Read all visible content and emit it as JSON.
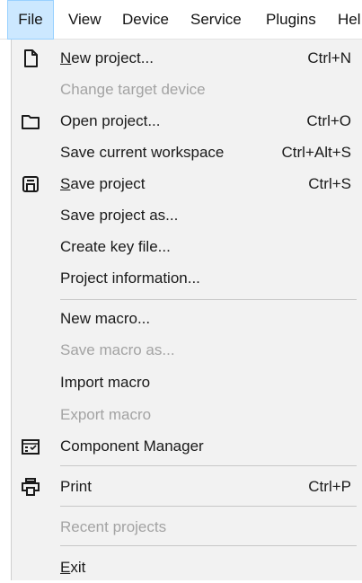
{
  "menubar": {
    "items": [
      "File",
      "View",
      "Device",
      "Service",
      "Plugins",
      "Hel"
    ]
  },
  "file_menu": {
    "new_project": {
      "label_u": "N",
      "label_rest": "ew project...",
      "shortcut": "Ctrl+N"
    },
    "change_target_device": {
      "label": "Change target device"
    },
    "open_project": {
      "label": "Open project...",
      "shortcut": "Ctrl+O"
    },
    "save_current_workspace": {
      "label": "Save current workspace",
      "shortcut": "Ctrl+Alt+S"
    },
    "save_project": {
      "label_u": "S",
      "label_rest": "ave project",
      "shortcut": "Ctrl+S"
    },
    "save_project_as": {
      "label": "Save project as..."
    },
    "create_key_file": {
      "label": "Create key file..."
    },
    "project_information": {
      "label": "Project information..."
    },
    "new_macro": {
      "label": "New macro..."
    },
    "save_macro_as": {
      "label": "Save macro as..."
    },
    "import_macro": {
      "label": "Import macro"
    },
    "export_macro": {
      "label": "Export macro"
    },
    "component_manager": {
      "label": "Component Manager"
    },
    "print": {
      "label": "Print",
      "shortcut": "Ctrl+P"
    },
    "recent_projects": {
      "label": "Recent projects"
    },
    "exit": {
      "label_u": "E",
      "label_rest": "xit"
    }
  },
  "icons": {
    "new_project": "new-document-icon",
    "open_project": "folder-icon",
    "save_project": "floppy-disk-icon",
    "component_manager": "component-manager-icon",
    "print": "printer-icon"
  },
  "colors": {
    "menu_background": "#f2f2f2",
    "active_menubar_highlight": "#cce8ff",
    "disabled_text": "#a3a3a3"
  }
}
